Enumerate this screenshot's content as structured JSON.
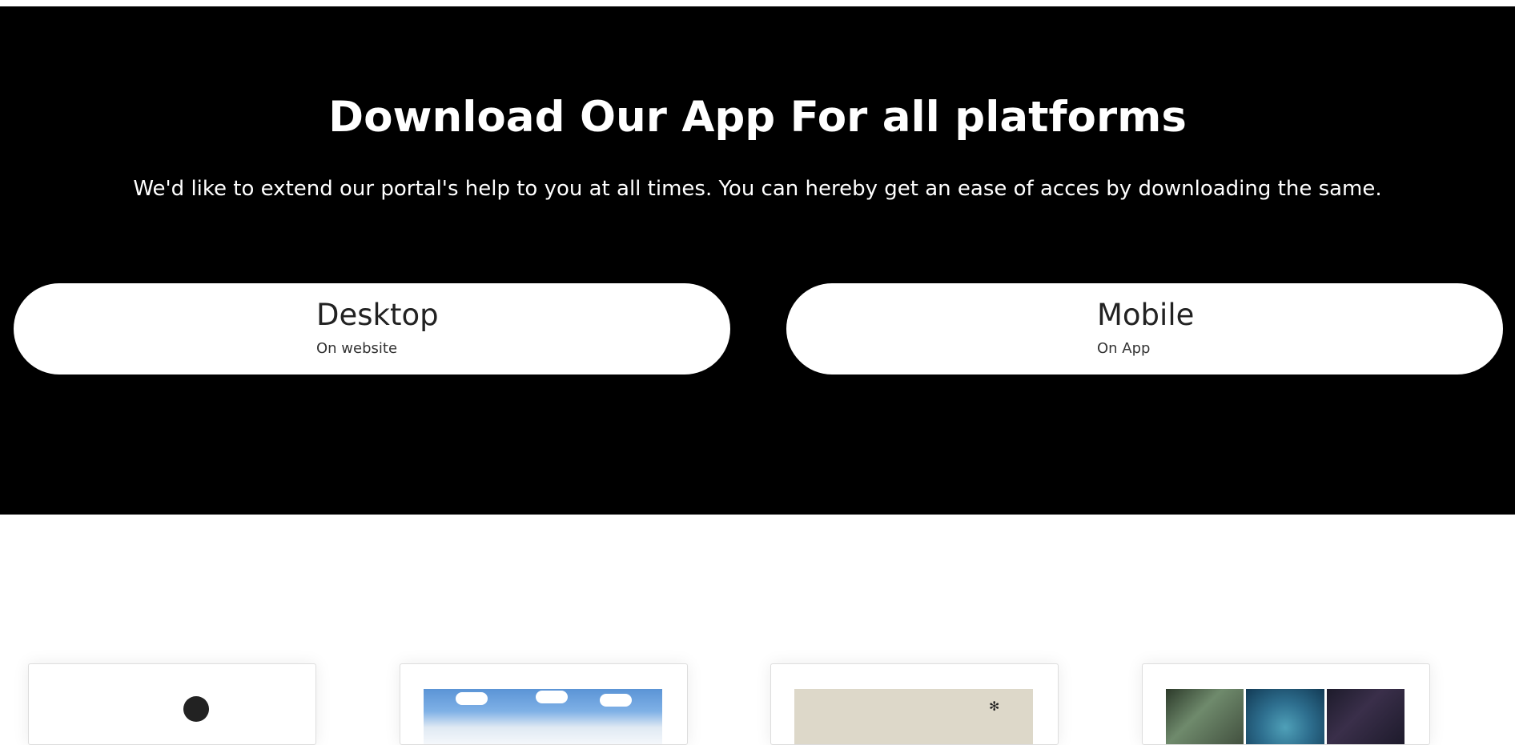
{
  "download": {
    "title": "Download Our App For all platforms",
    "subtitle": "We'd like to extend our portal's help to you at all times. You can hereby get an ease of acces by downloading the same.",
    "options": [
      {
        "title": "Desktop",
        "subtitle": "On website"
      },
      {
        "title": "Mobile",
        "subtitle": "On App"
      }
    ]
  },
  "colors": {
    "section_bg": "#000000",
    "pill_bg": "#ffffff",
    "page_bg": "#ffffff"
  },
  "cards": {
    "images": [
      "person-avatar-icon",
      "sky-landscape-image",
      "room-image",
      "craft-collage-image"
    ]
  }
}
